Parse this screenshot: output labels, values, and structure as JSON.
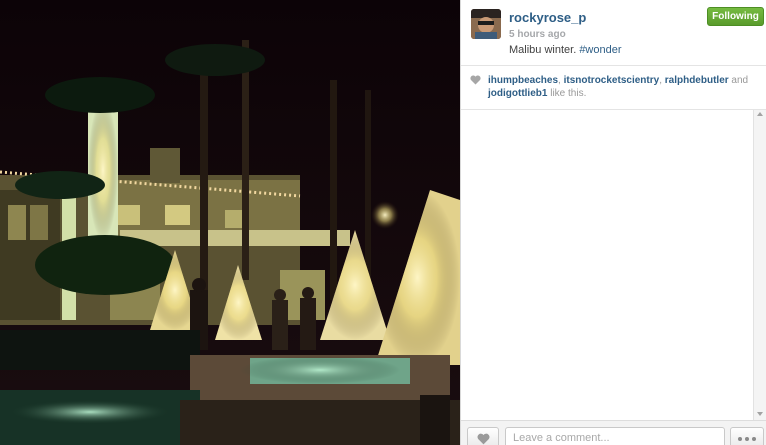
{
  "post": {
    "username": "rockyrose_p",
    "timestamp": "5 hours ago",
    "caption_text": "Malibu winter. ",
    "caption_hashtag": "#wonder",
    "follow_label": "Following"
  },
  "likes": {
    "likers": [
      "ihumpbeaches",
      "itsnotrocketscientry",
      "ralphdebutler",
      "jodigottlieb1"
    ],
    "separator": ", ",
    "conjunction": " and ",
    "suffix": " like this."
  },
  "footer": {
    "comment_placeholder": "Leave a comment..."
  },
  "colors": {
    "link": "#2e5e86",
    "follow_green": "#6bb138",
    "muted": "#999999"
  },
  "icons": {
    "like": "heart-icon",
    "more": "ellipsis-icon"
  }
}
